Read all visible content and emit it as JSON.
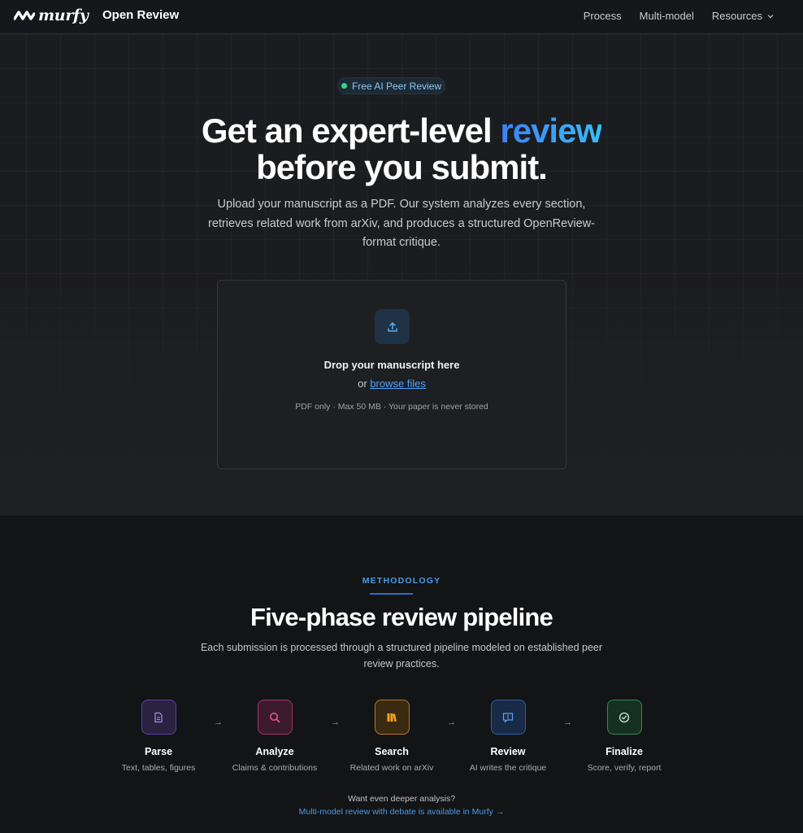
{
  "nav": {
    "brand": "murfy",
    "product": "Open Review",
    "links": [
      {
        "label": "Process"
      },
      {
        "label": "Multi-model"
      },
      {
        "label": "Resources"
      }
    ]
  },
  "hero": {
    "badge": "Free AI Peer Review",
    "title_part1": "Get an expert-level ",
    "title_accent": "review",
    "title_line2": "before you submit.",
    "subtitle": "Upload your manuscript as a PDF. Our system analyzes every section, retrieves related work from arXiv, and produces a structured OpenReview-format critique."
  },
  "dropzone": {
    "title": "Drop your manuscript here",
    "or": "or ",
    "browse": "browse files",
    "note": "PDF only · Max 50 MB · Your paper is never stored"
  },
  "methodology": {
    "eyebrow": "METHODOLOGY",
    "title": "Five-phase review pipeline",
    "subtitle": "Each submission is processed through a structured pipeline modeled on established peer review practices.",
    "steps": [
      {
        "title": "Parse",
        "desc": "Text, tables, figures",
        "icon": "document-icon",
        "color": "#8b5cf6"
      },
      {
        "title": "Analyze",
        "desc": "Claims & contributions",
        "icon": "magnify-icon",
        "color": "#ec4899"
      },
      {
        "title": "Search",
        "desc": "Related work on arXiv",
        "icon": "books-icon",
        "color": "#f59e0b"
      },
      {
        "title": "Review",
        "desc": "AI writes the critique",
        "icon": "comment-icon",
        "color": "#3b82f6"
      },
      {
        "title": "Finalize",
        "desc": "Score, verify, report",
        "icon": "check-circle-icon",
        "color": "#22c55e"
      }
    ],
    "arrow": "→",
    "deeper_question": "Want even deeper analysis?",
    "deeper_link": "Multi-model review with debate is available in Murfy →"
  },
  "colors": {
    "accent": "#3b82f6",
    "link": "#4a9ae8",
    "background": "#151618"
  }
}
